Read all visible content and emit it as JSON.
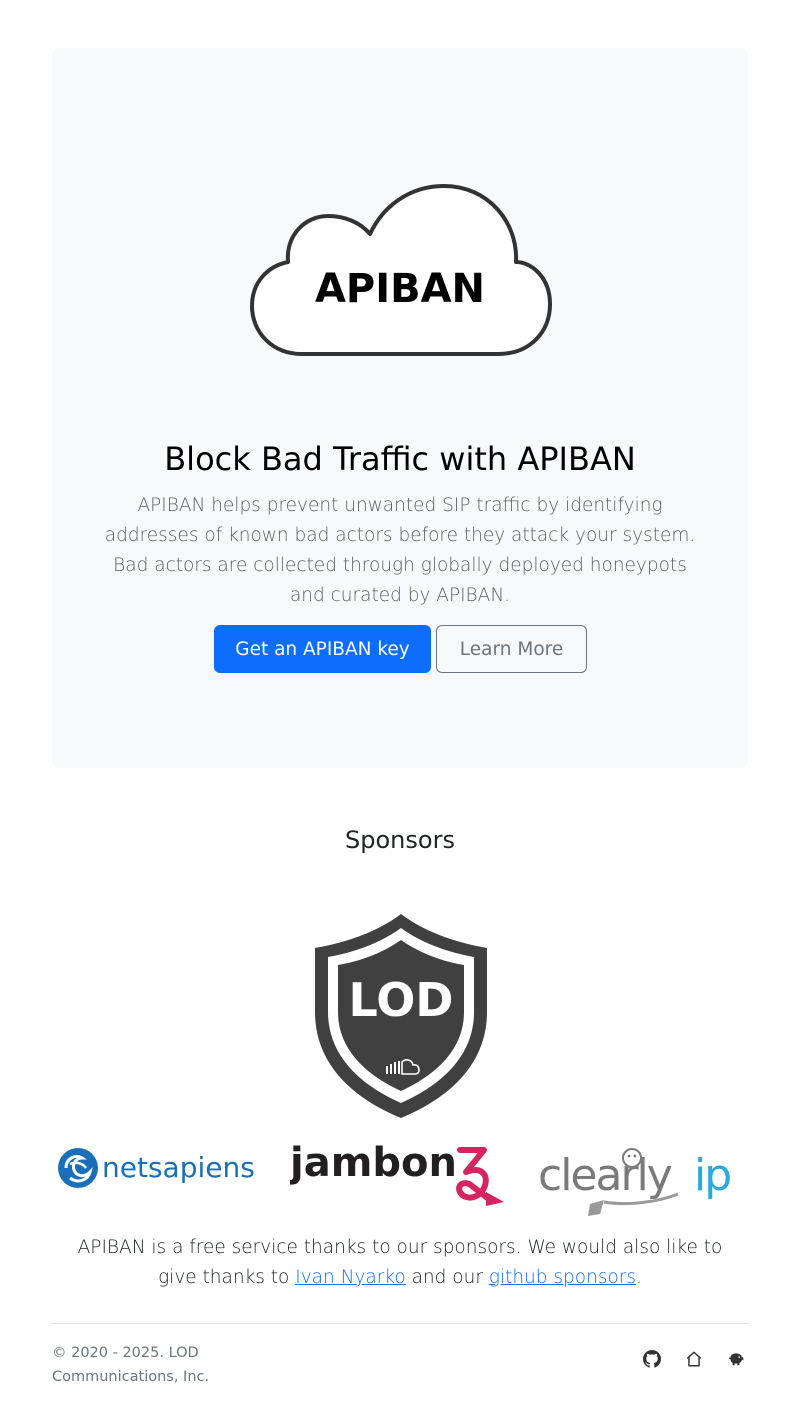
{
  "hero": {
    "logo_text": "APIBAN",
    "title": "Block Bad Traffic with APIBAN",
    "lead": "APIBAN helps prevent unwanted SIP traffic by identifying addresses of known bad actors before they attack your system. Bad actors are collected through globally deployed honeypots and curated by APIBAN.",
    "primary_button": "Get an APIBAN key",
    "secondary_button": "Learn More"
  },
  "sponsors": {
    "title": "Sponsors",
    "main_logo_text": "LOD",
    "logos": [
      {
        "text": "netsapiens",
        "icon": "netsapiens-logo"
      },
      {
        "text": "jambonz",
        "icon": "jambonz-logo"
      },
      {
        "text": "clearlyip",
        "icon": "clearlyip-logo"
      }
    ],
    "text_before": "APIBAN is a free service thanks to our sponsors. We would also like to give thanks to ",
    "link1": "Ivan Nyarko",
    "text_middle": " and our ",
    "link2": "github sponsors",
    "text_after": "."
  },
  "footer": {
    "copyright": "© 2020 - 2025. LOD Communications, Inc.",
    "icons": [
      "github-icon",
      "home-icon",
      "piggy-bank-icon"
    ]
  },
  "colors": {
    "primary": "#0d6efd",
    "hero_bg": "#f8f9fa",
    "muted": "#6c757d",
    "netsapiens_blue": "#1a6fb8",
    "jambonz_pink": "#d6245e",
    "clearlyip_blue": "#29a9e0"
  }
}
